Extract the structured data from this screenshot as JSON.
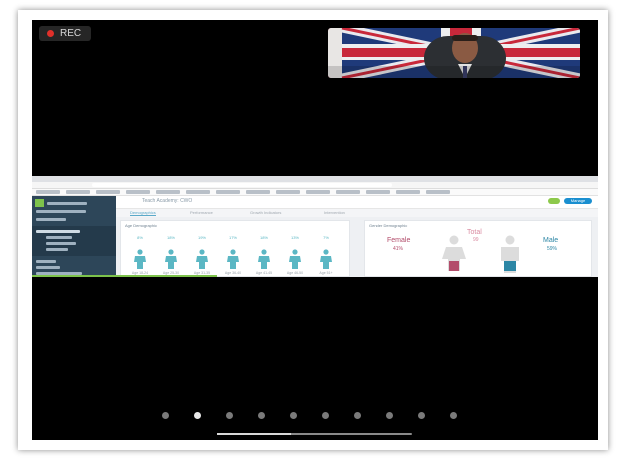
{
  "recording": {
    "label": "REC",
    "color": "#e0302a"
  },
  "shared_screen": {
    "app_title": "Teach Academy: CWO",
    "action_button": "Manage",
    "tabs": [
      {
        "label": "Demographics",
        "active": true
      },
      {
        "label": "Performance",
        "active": false
      },
      {
        "label": "Growth Indicators",
        "active": false
      },
      {
        "label": "Intervention",
        "active": false
      }
    ],
    "age_card": {
      "title": "Age Demographic",
      "percents": [
        "8%",
        "18%",
        "19%",
        "17%",
        "18%",
        "13%",
        "7%"
      ],
      "labels": [
        "Age 18-24",
        "Age 25-30",
        "Age 31-35",
        "Age 36-40",
        "Age 41-45",
        "Age 46-50",
        "Age 51+"
      ]
    },
    "gender_card": {
      "title": "Gender Demographic",
      "female_label": "Female",
      "female_pct": "41%",
      "total_label": "Total",
      "total_value": "99",
      "male_label": "Male",
      "male_pct": "59%"
    }
  },
  "carousel": {
    "page_count": 10,
    "active_index": 1
  },
  "colors": {
    "accent_teal": "#5bb7c4",
    "female": "#b34d6b",
    "male": "#2c86a5",
    "sidebar": "#2d4659"
  }
}
